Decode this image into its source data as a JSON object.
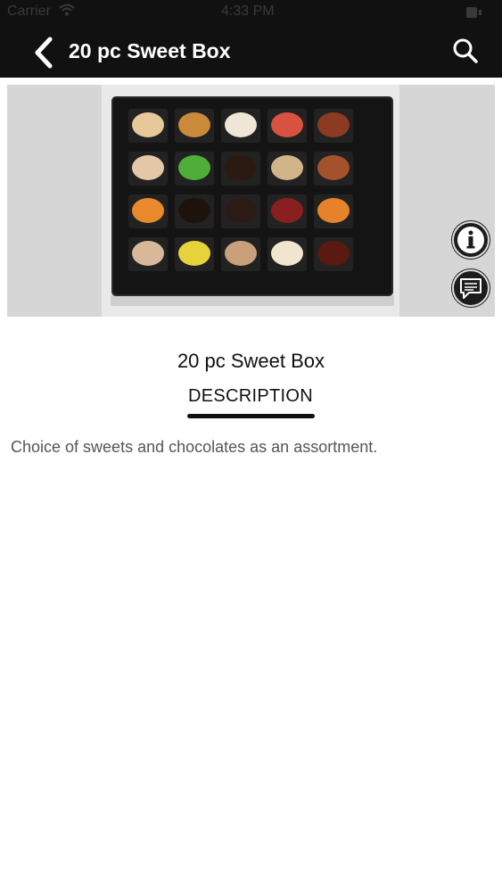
{
  "status_bar": {
    "carrier": "Carrier",
    "time": "4:33 PM",
    "wifi_icon": "wifi-icon",
    "battery_icon": "battery-icon"
  },
  "nav": {
    "title": "20 pc Sweet Box",
    "back_icon": "chevron-left-icon",
    "search_icon": "search-icon"
  },
  "hero": {
    "image_alt": "20 pc Sweet Box photo",
    "sweets": [
      [
        "#e8c79a",
        "#c98a3a",
        "#efe6d6",
        "#d9523f",
        "#8c3b22"
      ],
      [
        "#e2c8a6",
        "#4fae3a",
        "#2a1a12",
        "#d2b48a",
        "#a4522c"
      ],
      [
        "#e88a2c",
        "#1e120c",
        "#2c1a14",
        "#8a1f1f",
        "#e8822a"
      ],
      [
        "#d9b89a",
        "#e6d23a",
        "#c9a07a",
        "#f0e6cf",
        "#5a1a12"
      ]
    ]
  },
  "actions": {
    "info_icon": "info-icon",
    "chat_icon": "chat-bubble-icon"
  },
  "product": {
    "title": "20 pc Sweet Box",
    "tab_label": "DESCRIPTION",
    "description": "Choice of sweets and chocolates as an assortment."
  },
  "colors": {
    "nav_bg": "#111111",
    "text_primary": "#111111",
    "text_secondary": "#555555"
  }
}
